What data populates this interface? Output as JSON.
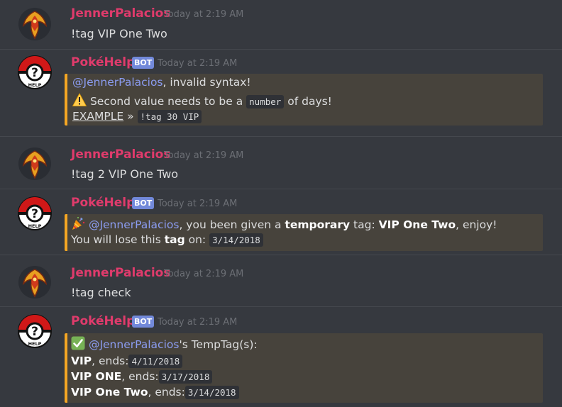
{
  "users": {
    "jenner": "JennerPalacios",
    "bot": "PokéHelp",
    "bot_badge": "BOT"
  },
  "timestamp": "Today at 2:19 AM",
  "messages": [
    {
      "content": "!tag VIP One Two"
    },
    {
      "line1_mention": "@JennerPalacios",
      "line1_rest": ", invalid syntax!",
      "line2_pre": "Second value needs to be a",
      "line2_code": "number",
      "line2_post": "of days!",
      "line3_link": "EXAMPLE",
      "line3_sep": "»",
      "line3_code": "!tag 30 VIP"
    },
    {
      "content": "!tag 2 VIP One Two"
    },
    {
      "line1_mention": "@JennerPalacios",
      "line1_a": ", you been given a",
      "line1_b1": "temporary",
      "line1_c": "tag:",
      "line1_b2": "VIP One Two",
      "line1_d": ", enjoy!",
      "line2_a": "You will lose this",
      "line2_b": "tag",
      "line2_c": "on:",
      "line2_code": "3/14/2018"
    },
    {
      "content": "!tag check"
    },
    {
      "line1_mention": "@JennerPalacios",
      "line1_rest": "'s TempTag(s):",
      "tags": [
        {
          "name": "VIP",
          "label": ", ends:",
          "date": "4/11/2018"
        },
        {
          "name": "VIP ONE",
          "label": ", ends:",
          "date": "3/17/2018"
        },
        {
          "name": "VIP One Two",
          "label": ", ends:",
          "date": "3/14/2018"
        }
      ]
    }
  ],
  "colors": {
    "background": "#36393f",
    "username": "#e03b6c",
    "mention": "#8b9cf0",
    "embed_border": "#f5a623",
    "bot_badge": "#7289da"
  },
  "icons": {
    "jenner_avatar": "team-valor-bird-icon",
    "bot_avatar": "pokeball-help-icon",
    "warning": "warning-icon",
    "party": "party-popper-icon",
    "check": "check-mark-icon"
  }
}
